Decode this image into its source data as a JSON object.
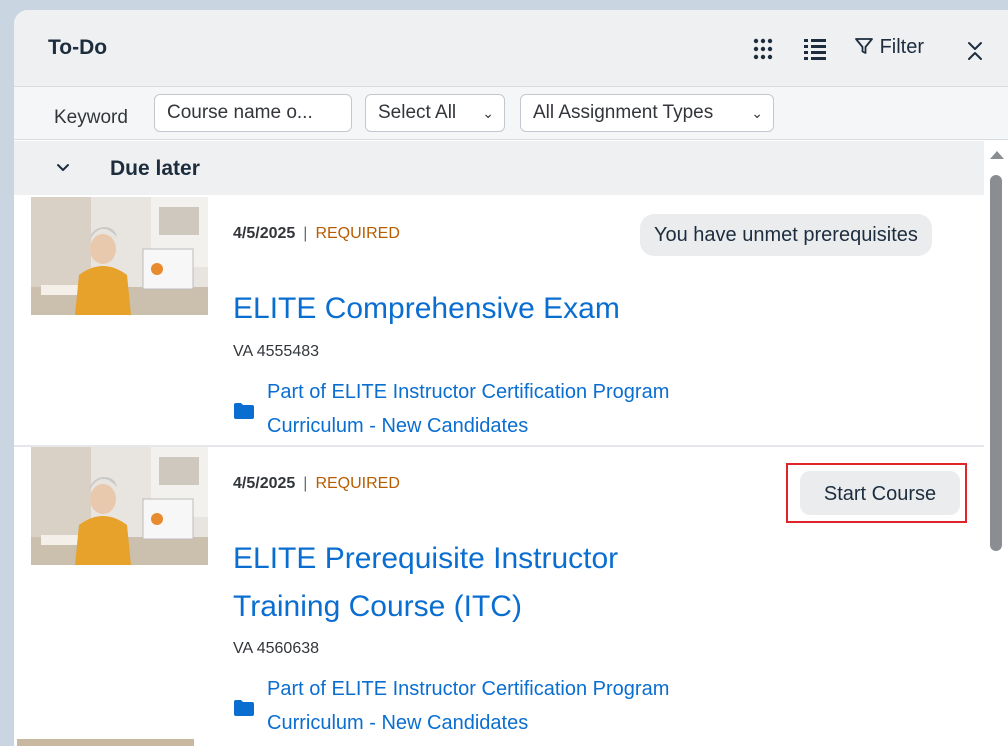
{
  "header": {
    "title": "To-Do",
    "filter_label": "Filter"
  },
  "filters": {
    "keyword_label": "Keyword",
    "keyword_placeholder": "Course name o...",
    "status_select": "Select All",
    "type_select": "All Assignment Types"
  },
  "group": {
    "title": "Due later"
  },
  "items": [
    {
      "date": "4/5/2025",
      "separator": "|",
      "status": "REQUIRED",
      "title": "ELITE Comprehensive Exam",
      "code": "VA 4555483",
      "curriculum_line1": "Part of ELITE Instructor Certification Program",
      "curriculum_line2": "Curriculum - New Candidates",
      "badge": "You have unmet prerequisites"
    },
    {
      "date": "4/5/2025",
      "separator": "|",
      "status": "REQUIRED",
      "title_line1": "ELITE Prerequisite Instructor",
      "title_line2": "Training Course (ITC)",
      "code": "VA 4560638",
      "curriculum_line1": "Part of ELITE Instructor Certification Program",
      "curriculum_line2": "Curriculum - New Candidates",
      "action_label": "Start Course"
    }
  ],
  "colors": {
    "link": "#0a6ed1",
    "required": "#b85c00",
    "highlight": "#e0242c"
  }
}
